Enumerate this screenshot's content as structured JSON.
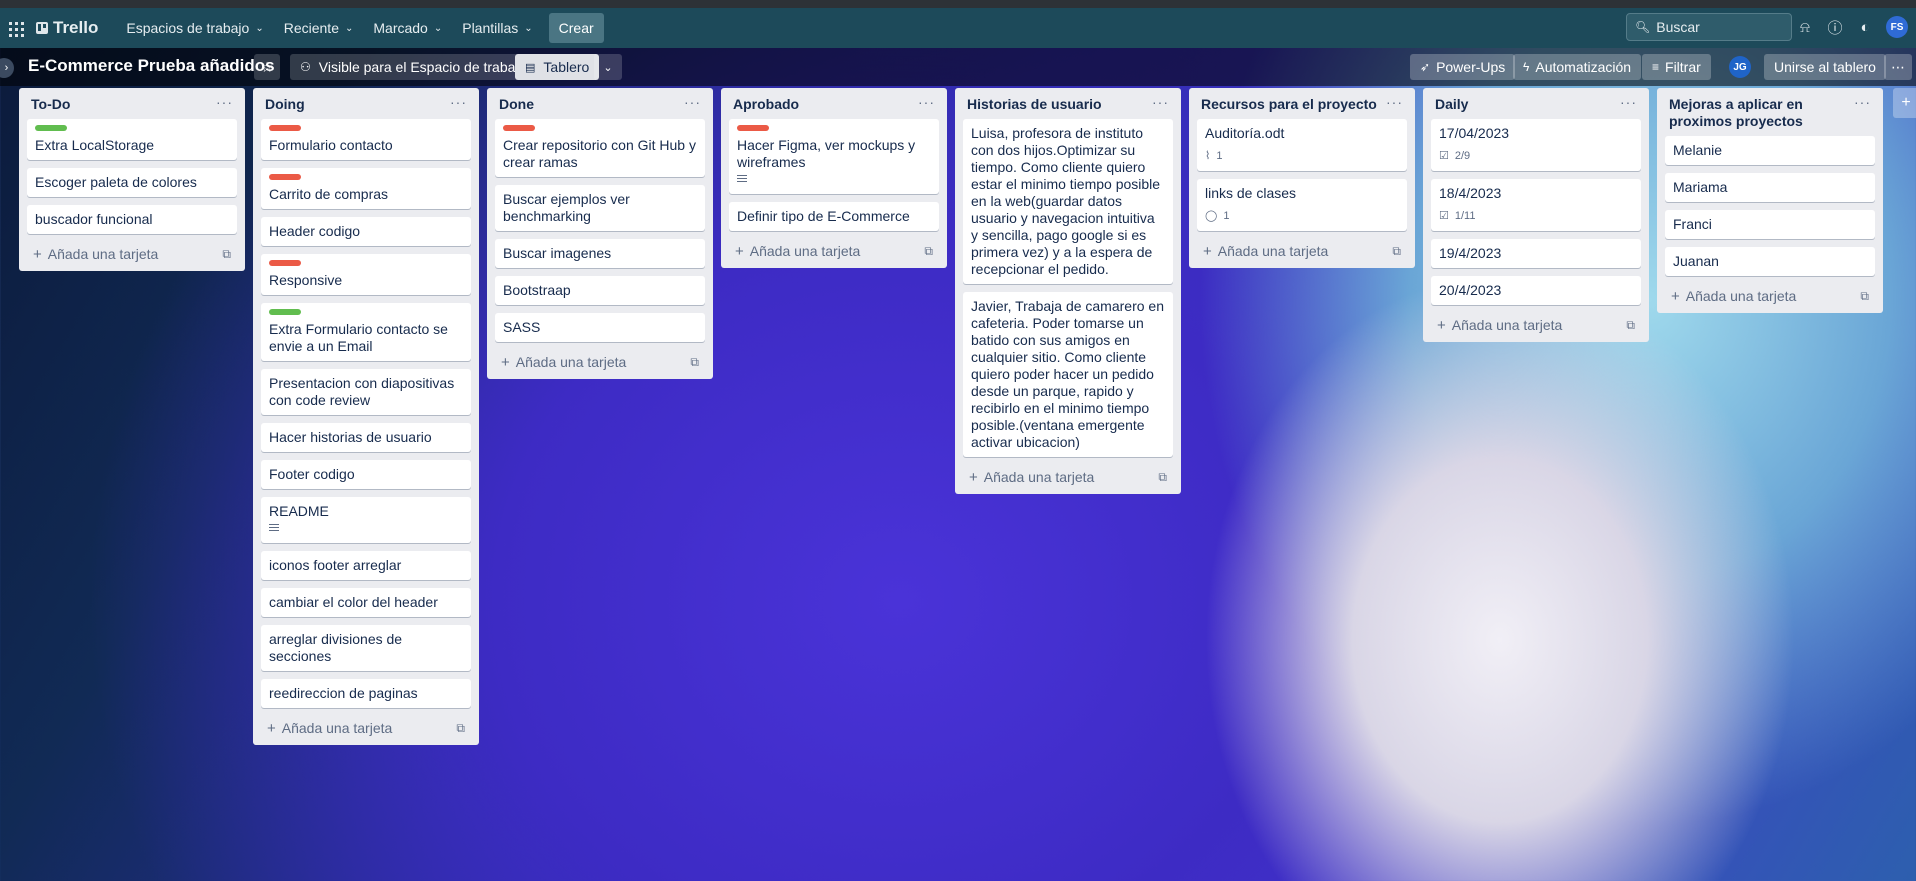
{
  "topbar": {
    "logo": "Trello",
    "nav": [
      {
        "label": "Espacios de trabajo"
      },
      {
        "label": "Reciente"
      },
      {
        "label": "Marcado"
      },
      {
        "label": "Plantillas"
      }
    ],
    "create": "Crear",
    "search_placeholder": "Buscar",
    "avatar": "FS"
  },
  "board": {
    "title": "E-Commerce Prueba añadidos",
    "visibility": "Visible para el Espacio de trabajo",
    "view": "Tablero",
    "powerups": "Power-Ups",
    "automation": "Automatización",
    "filter": "Filtrar",
    "member_avatar": "JG",
    "join": "Unirse al tablero"
  },
  "add_card": "Añada una tarjeta",
  "lists": [
    {
      "title": "To-Do",
      "cards": [
        {
          "labels": [
            "green"
          ],
          "text": "Extra LocalStorage"
        },
        {
          "labels": [],
          "text": "Escoger paleta de colores"
        },
        {
          "labels": [],
          "text": "buscador funcional"
        }
      ]
    },
    {
      "title": "Doing",
      "cards": [
        {
          "labels": [
            "red"
          ],
          "text": "Formulario contacto"
        },
        {
          "labels": [
            "red"
          ],
          "text": "Carrito de compras"
        },
        {
          "labels": [],
          "text": "Header codigo"
        },
        {
          "labels": [
            "red"
          ],
          "text": "Responsive"
        },
        {
          "labels": [
            "green"
          ],
          "text": "Extra Formulario contacto se envie a un Email"
        },
        {
          "labels": [],
          "text": "Presentacion con diapositivas con code review"
        },
        {
          "labels": [],
          "text": "Hacer historias de usuario"
        },
        {
          "labels": [],
          "text": "Footer codigo"
        },
        {
          "labels": [],
          "text": "README",
          "description": true
        },
        {
          "labels": [],
          "text": "iconos footer arreglar"
        },
        {
          "labels": [],
          "text": "cambiar el color del header"
        },
        {
          "labels": [],
          "text": "arreglar divisiones de secciones"
        },
        {
          "labels": [],
          "text": "reedireccion de paginas"
        }
      ]
    },
    {
      "title": "Done",
      "cards": [
        {
          "labels": [
            "red"
          ],
          "text": "Crear repositorio con Git Hub y crear ramas"
        },
        {
          "labels": [],
          "text": "Buscar ejemplos ver benchmarking"
        },
        {
          "labels": [],
          "text": "Buscar imagenes"
        },
        {
          "labels": [],
          "text": "Bootstraap"
        },
        {
          "labels": [],
          "text": "SASS"
        }
      ]
    },
    {
      "title": "Aprobado",
      "cards": [
        {
          "labels": [
            "red"
          ],
          "text": "Hacer Figma, ver mockups y wireframes",
          "description": true
        },
        {
          "labels": [],
          "text": "Definir tipo de E-Commerce"
        }
      ]
    },
    {
      "title": "Historias de usuario",
      "cards": [
        {
          "labels": [],
          "text": "Luisa, profesora de instituto con dos hijos.Optimizar su tiempo. Como cliente quiero estar el minimo tiempo posible en la web(guardar datos usuario y navegacion intuitiva y sencilla, pago google si es primera vez) y a la espera de recepcionar el pedido."
        },
        {
          "labels": [],
          "text": "Javier, Trabaja de camarero en cafeteria. Poder tomarse un batido con sus amigos en cualquier sitio. Como cliente quiero poder hacer un pedido desde un parque, rapido y recibirlo en el minimo tiempo posible.(ventana emergente activar ubicacion)"
        }
      ]
    },
    {
      "title": "Recursos para el proyecto",
      "cards": [
        {
          "labels": [],
          "text": "Auditoría.odt",
          "badge_icon": "attachment-icon",
          "badge": "1"
        },
        {
          "labels": [],
          "text": "links de clases",
          "badge_icon": "comment-icon",
          "badge": "1"
        }
      ]
    },
    {
      "title": "Daily",
      "cards": [
        {
          "labels": [],
          "text": "17/04/2023",
          "badge_icon": "checklist-icon",
          "badge": "2/9"
        },
        {
          "labels": [],
          "text": "18/4/2023",
          "badge_icon": "checklist-icon",
          "badge": "1/11"
        },
        {
          "labels": [],
          "text": "19/4/2023"
        },
        {
          "labels": [],
          "text": "20/4/2023"
        }
      ]
    },
    {
      "title": "Mejoras a aplicar en proximos proyectos",
      "cards": [
        {
          "labels": [],
          "text": "Melanie"
        },
        {
          "labels": [],
          "text": "Mariama"
        },
        {
          "labels": [],
          "text": "Franci"
        },
        {
          "labels": [],
          "text": "Juanan"
        }
      ]
    }
  ]
}
